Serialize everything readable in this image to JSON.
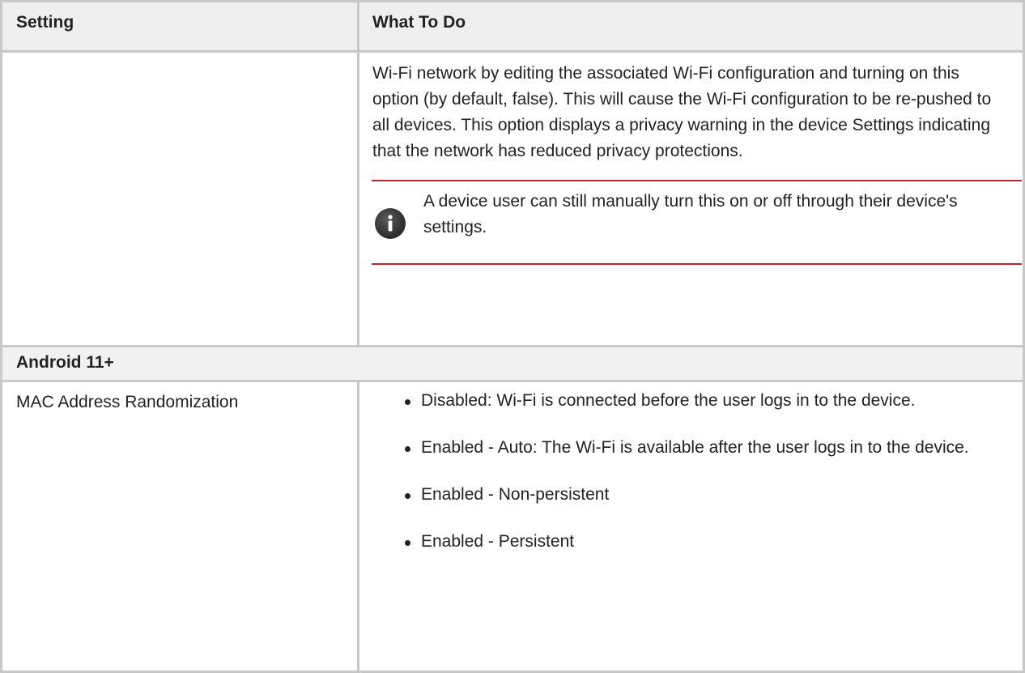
{
  "table": {
    "header": {
      "setting": "Setting",
      "what_to_do": "What To Do"
    },
    "continued_row": {
      "paragraph": "Wi-Fi network by editing the associated Wi-Fi configuration and turning on this option (by default, false). This will cause the Wi-Fi configuration to be re-pushed to all devices. This option displays a privacy warning in the device Settings indicating that the network has reduced privacy protections.",
      "note": {
        "icon": "info-icon",
        "text": "A device user can still manually turn this on or off through their device's settings."
      }
    },
    "section": {
      "label": "Android 11+"
    },
    "mac_row": {
      "setting": "MAC Address Randomization",
      "items": [
        "Disabled: Wi-Fi is connected before the user logs in to the device.",
        "Enabled - Auto: The Wi-Fi is available after the user logs in to the device.",
        "Enabled - Non-persistent",
        "Enabled - Persistent"
      ]
    }
  },
  "colors": {
    "border": "#c8c8c8",
    "header_bg": "#efefef",
    "note_rule": "#c9202e",
    "text": "#222222"
  }
}
